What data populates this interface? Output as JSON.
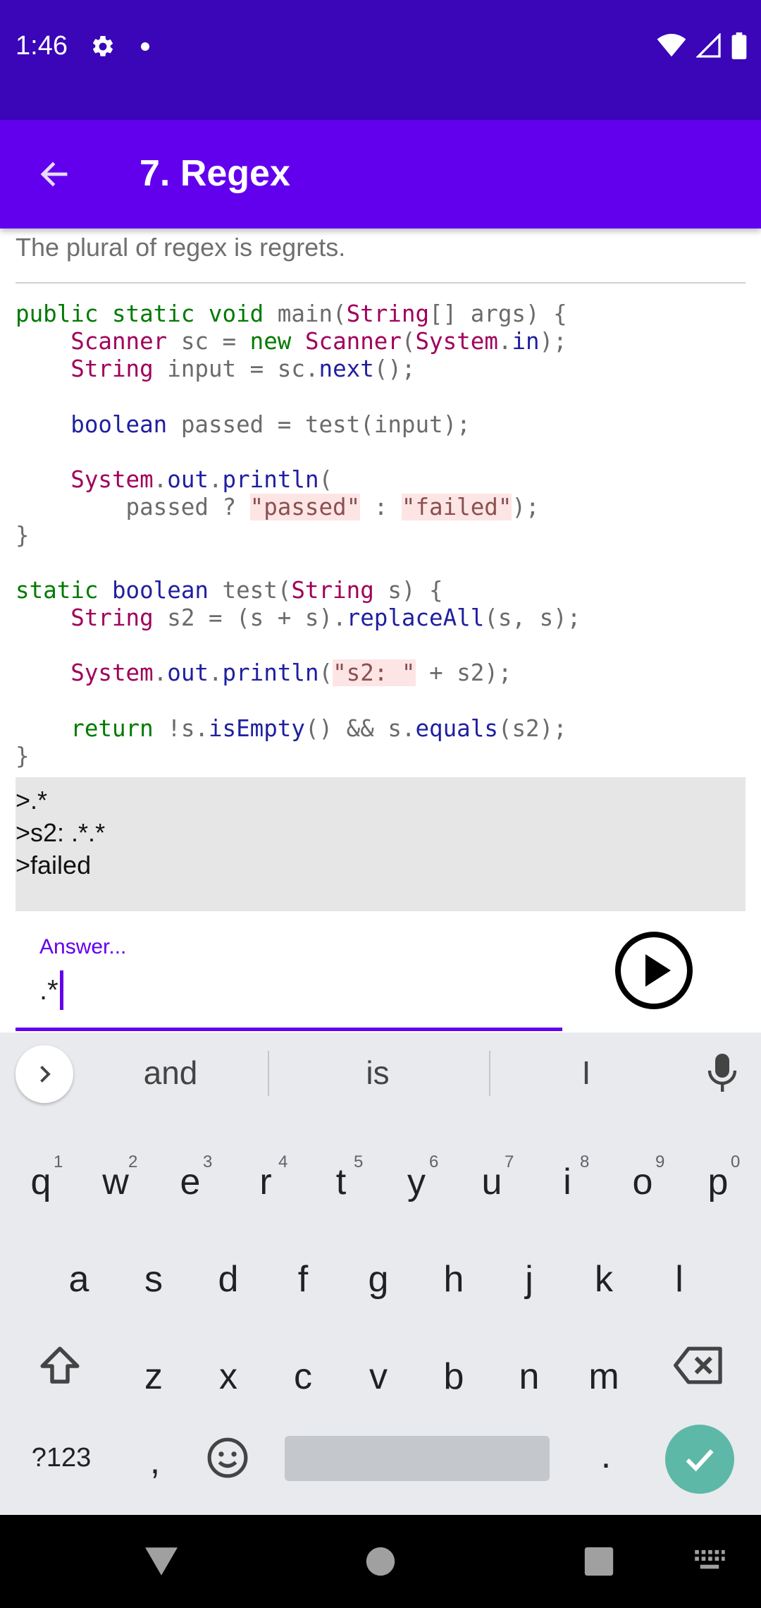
{
  "status_bar": {
    "time": "1:46"
  },
  "app_bar": {
    "title": "7. Regex"
  },
  "description": "The plural of regex is regrets.",
  "console": {
    "lines": [
      ">.*",
      ">s2: .*.*",
      ">failed"
    ]
  },
  "answer": {
    "label": "Answer...",
    "value": ".*"
  },
  "keyboard": {
    "suggestions": [
      "and",
      "is",
      "I"
    ],
    "row1": [
      "q",
      "w",
      "e",
      "r",
      "t",
      "y",
      "u",
      "i",
      "o",
      "p"
    ],
    "row1_hints": [
      "1",
      "2",
      "3",
      "4",
      "5",
      "6",
      "7",
      "8",
      "9",
      "0"
    ],
    "row2": [
      "a",
      "s",
      "d",
      "f",
      "g",
      "h",
      "j",
      "k",
      "l"
    ],
    "row3": [
      "z",
      "x",
      "c",
      "v",
      "b",
      "n",
      "m"
    ],
    "symbols_key": "?123",
    "comma_key": ",",
    "period_key": "."
  },
  "colors": {
    "status_bar": "#3a06b8",
    "app_bar": "#6200ee",
    "accent": "#6200ee",
    "enter_key": "#5db8a8"
  }
}
